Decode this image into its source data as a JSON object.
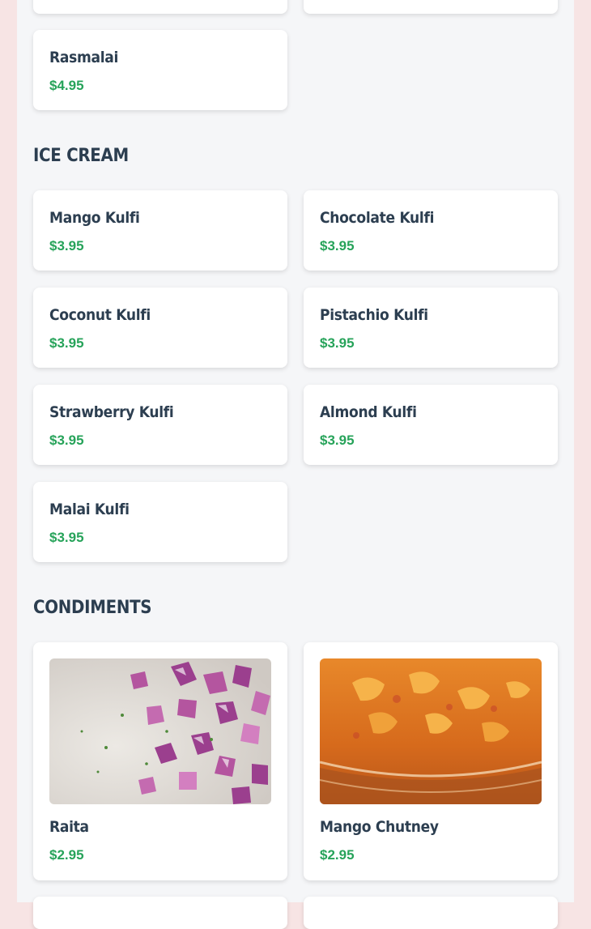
{
  "desserts_partial": {
    "items": [
      {
        "name": "Rasmalai",
        "price": "$4.95"
      }
    ]
  },
  "ice_cream": {
    "title": "ICE CREAM",
    "items": [
      {
        "name": "Mango Kulfi",
        "price": "$3.95"
      },
      {
        "name": "Chocolate Kulfi",
        "price": "$3.95"
      },
      {
        "name": "Coconut Kulfi",
        "price": "$3.95"
      },
      {
        "name": "Pistachio Kulfi",
        "price": "$3.95"
      },
      {
        "name": "Strawberry Kulfi",
        "price": "$3.95"
      },
      {
        "name": "Almond Kulfi",
        "price": "$3.95"
      },
      {
        "name": "Malai Kulfi",
        "price": "$3.95"
      }
    ]
  },
  "condiments": {
    "title": "CONDIMENTS",
    "items": [
      {
        "name": "Raita",
        "price": "$2.95",
        "image": "raita-photo"
      },
      {
        "name": "Mango Chutney",
        "price": "$2.95",
        "image": "mango-chutney-photo"
      }
    ]
  },
  "colors": {
    "page_bg": "#f7e4e4",
    "content_bg": "#f5f6f8",
    "card_bg": "#ffffff",
    "heading": "#2c3e50",
    "price": "#27a35a"
  }
}
